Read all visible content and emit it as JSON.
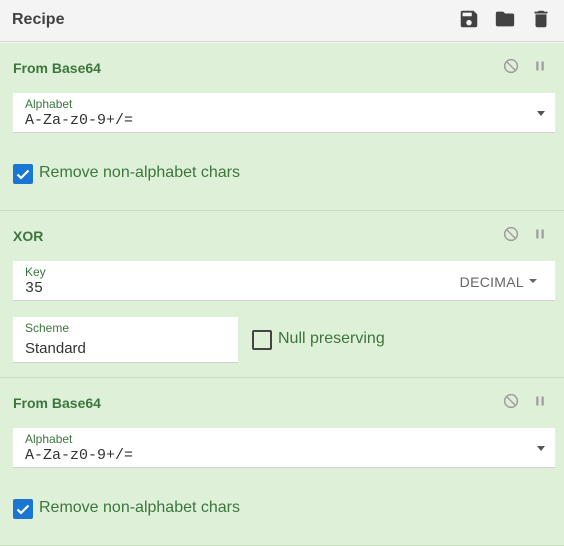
{
  "header": {
    "title": "Recipe"
  },
  "operations": [
    {
      "name": "From Base64",
      "alphabet": {
        "label": "Alphabet",
        "value": "A-Za-z0-9+/="
      },
      "checkbox": {
        "label": "Remove non-alphabet chars",
        "checked": true
      }
    },
    {
      "name": "XOR",
      "key": {
        "label": "Key",
        "value": "35",
        "format": "DECIMAL"
      },
      "scheme": {
        "label": "Scheme",
        "value": "Standard"
      },
      "checkbox": {
        "label": "Null preserving",
        "checked": false
      }
    },
    {
      "name": "From Base64",
      "alphabet": {
        "label": "Alphabet",
        "value": "A-Za-z0-9+/="
      },
      "checkbox": {
        "label": "Remove non-alphabet chars",
        "checked": true
      }
    }
  ],
  "colors": {
    "operation_bg": "#dff0d8",
    "operation_text": "#3c763d",
    "checkbox_checked": "#1976d2"
  },
  "icons": {
    "header": [
      "save-icon",
      "folder-icon",
      "trash-icon"
    ],
    "operation": [
      "disable-icon",
      "pause-icon"
    ]
  }
}
